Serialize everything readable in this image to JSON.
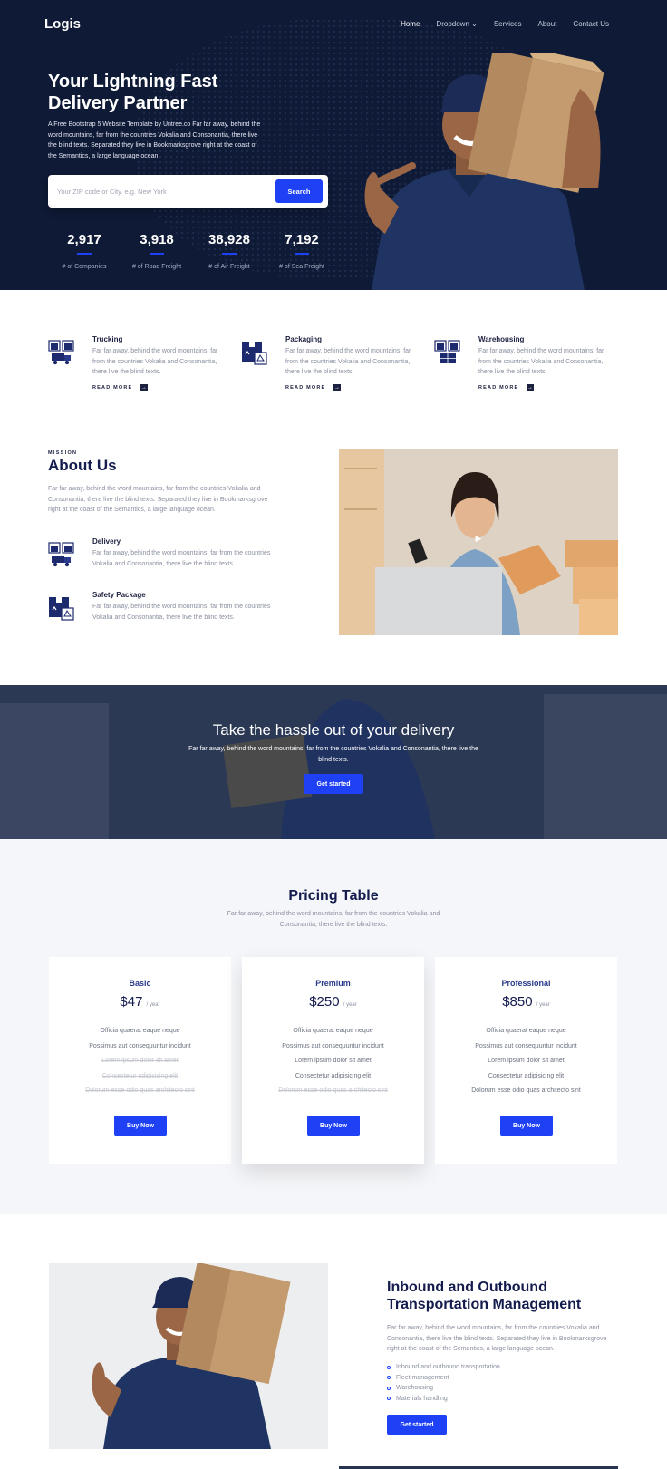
{
  "nav": {
    "logo": "Logis",
    "items": [
      "Home",
      "Dropdown",
      "Services",
      "About",
      "Contact Us"
    ]
  },
  "hero": {
    "title": "Your Lightning Fast Delivery Partner",
    "text": "A Free Bootstrap 5 Website Template by Untree.co Far far away, behind the word mountains, far from the countries Vokalia and Consonantia, there live the blind texts. Separated they live in Bookmarksgrove right at the coast of the Semantics, a large language ocean.",
    "search_placeholder": "Your ZIP code or City. e.g. New York",
    "search_button": "Search",
    "stats": [
      {
        "num": "2,917",
        "label": "# of Companies"
      },
      {
        "num": "3,918",
        "label": "# of Road Freight"
      },
      {
        "num": "38,928",
        "label": "# of Air Freight"
      },
      {
        "num": "7,192",
        "label": "# of Sea Freight"
      }
    ]
  },
  "services": [
    {
      "title": "Trucking",
      "text": "Far far away, behind the word mountains, far from the countries Vokalia and Consonantia, there live the blind texts.",
      "link": "READ MORE"
    },
    {
      "title": "Packaging",
      "text": "Far far away, behind the word mountains, far from the countries Vokalia and Consonantia, there live the blind texts.",
      "link": "READ MORE"
    },
    {
      "title": "Warehousing",
      "text": "Far far away, behind the word mountains, far from the countries Vokalia and Consonantia, there live the blind texts.",
      "link": "READ MORE"
    }
  ],
  "about": {
    "kicker": "MISSION",
    "title": "About Us",
    "text": "Far far away, behind the word mountains, far from the countries Vokalia and Consonantia, there live the blind texts. Separated they live in Bookmarksgrove right at the coast of the Semantics, a large language ocean.",
    "features": [
      {
        "title": "Delivery",
        "text": "Far far away, behind the word mountains, far from the countries Vokalia and Consonantia, there live the blind texts."
      },
      {
        "title": "Safety Package",
        "text": "Far far away, behind the word mountains, far from the countries Vokalia and Consonantia, there live the blind texts."
      }
    ]
  },
  "cta": {
    "title": "Take the hassle out of your delivery",
    "text": "Far far away, behind the word mountains, far from the countries Vokalia and Consonantia, there live the blind texts.",
    "button": "Get started"
  },
  "pricing": {
    "title": "Pricing Table",
    "text": "Far far away, behind the word mountains, far from the countries Vokalia and Consonantia, there live the blind texts.",
    "per": "/ year",
    "button": "Buy Now",
    "plans": [
      {
        "name": "Basic",
        "price": "$47",
        "features": [
          "Officia quaerat eaque neque",
          "Possimus aut consequuntur incidunt",
          "Lorem ipsum dolor sit amet",
          "Consectetur adipisicing elit",
          "Dolorum esse odio quas architecto sint"
        ],
        "disabled_from": 2
      },
      {
        "name": "Premium",
        "price": "$250",
        "features": [
          "Officia quaerat eaque neque",
          "Possimus aut consequuntur incidunt",
          "Lorem ipsum dolor sit amet",
          "Consectetur adipisicing elit",
          "Dolorum esse odio quas architecto sint"
        ],
        "disabled_from": 4
      },
      {
        "name": "Professional",
        "price": "$850",
        "features": [
          "Officia quaerat eaque neque",
          "Possimus aut consequuntur incidunt",
          "Lorem ipsum dolor sit amet",
          "Consectetur adipisicing elit",
          "Dolorum esse odio quas architecto sint"
        ],
        "disabled_from": 5
      }
    ]
  },
  "transport": {
    "title": "Inbound and Outbound Transportation Management",
    "text": "Far far away, behind the word mountains, far from the countries Vokalia and Consonantia, there live the blind texts. Separated they live in Bookmarksgrove right at the coast of the Semantics, a large language ocean.",
    "list": [
      "Inbound and outbound transportation",
      "Fleet management",
      "Warehousing",
      "Materials handling"
    ],
    "button": "Get started"
  },
  "colors": {
    "navy": "#0f1a36",
    "accent": "#1e41f5",
    "heading": "#141b4d"
  }
}
